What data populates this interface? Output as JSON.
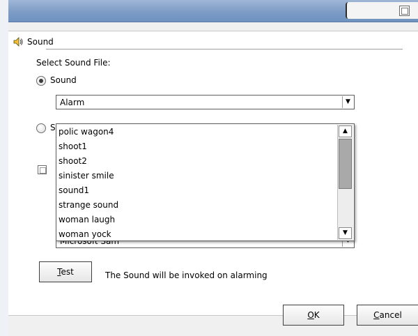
{
  "section": {
    "title": "Sound"
  },
  "labels": {
    "select_sound_file": "Select Sound File:"
  },
  "radio_sound": {
    "label": "Sound",
    "checked": true
  },
  "radio_other": {
    "label": "S",
    "checked": false
  },
  "sound_combo": {
    "value": "Alarm"
  },
  "dropdown_items": [
    "polic wagon4",
    "shoot1",
    "shoot2",
    "sinister smile",
    "sound1",
    "strange sound",
    "woman laugh",
    "woman yock"
  ],
  "voice_combo": {
    "value": "Microsoft Sam"
  },
  "test_button": {
    "mnemonic": "T",
    "rest": "est"
  },
  "status_text": "The Sound will be invoked on alarming",
  "ok_button": {
    "mnemonic": "O",
    "rest": "K"
  },
  "cancel_button": {
    "mnemonic": "C",
    "rest": "ancel"
  },
  "icons": {
    "speaker": "speaker-icon",
    "dropdown_arrow": "arrow-down-icon",
    "scroll_up": "arrow-up-icon",
    "scroll_down": "arrow-down-icon"
  },
  "colors": {
    "title_bar": "#7d9cc6",
    "scroll_thumb": "#a9a9a9"
  }
}
